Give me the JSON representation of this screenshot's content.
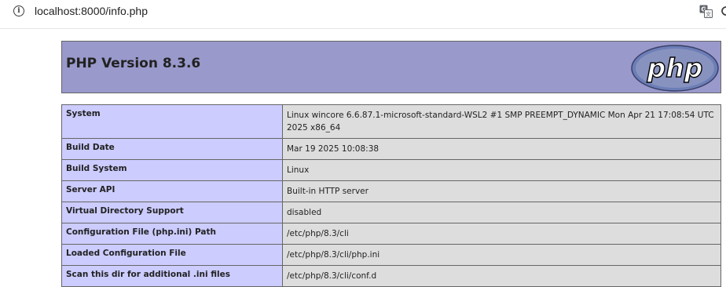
{
  "browser": {
    "url": "localhost:8000/info.php",
    "info_icon": "info-icon",
    "translate_icon": "translate-icon"
  },
  "header": {
    "title": "PHP Version 8.3.6",
    "logo_text": "php",
    "background": "#9999cc"
  },
  "colors": {
    "label_cell": "#ccccff",
    "value_cell": "#dddddd",
    "border": "#666666"
  },
  "rows": [
    {
      "label": "System",
      "value": "Linux wincore 6.6.87.1-microsoft-standard-WSL2 #1 SMP PREEMPT_DYNAMIC Mon Apr 21 17:08:54 UTC 2025 x86_64"
    },
    {
      "label": "Build Date",
      "value": "Mar 19 2025 10:08:38"
    },
    {
      "label": "Build System",
      "value": "Linux"
    },
    {
      "label": "Server API",
      "value": "Built-in HTTP server"
    },
    {
      "label": "Virtual Directory Support",
      "value": "disabled"
    },
    {
      "label": "Configuration File (php.ini) Path",
      "value": "/etc/php/8.3/cli"
    },
    {
      "label": "Loaded Configuration File",
      "value": "/etc/php/8.3/cli/php.ini"
    },
    {
      "label": "Scan this dir for additional .ini files",
      "value": "/etc/php/8.3/cli/conf.d"
    }
  ]
}
